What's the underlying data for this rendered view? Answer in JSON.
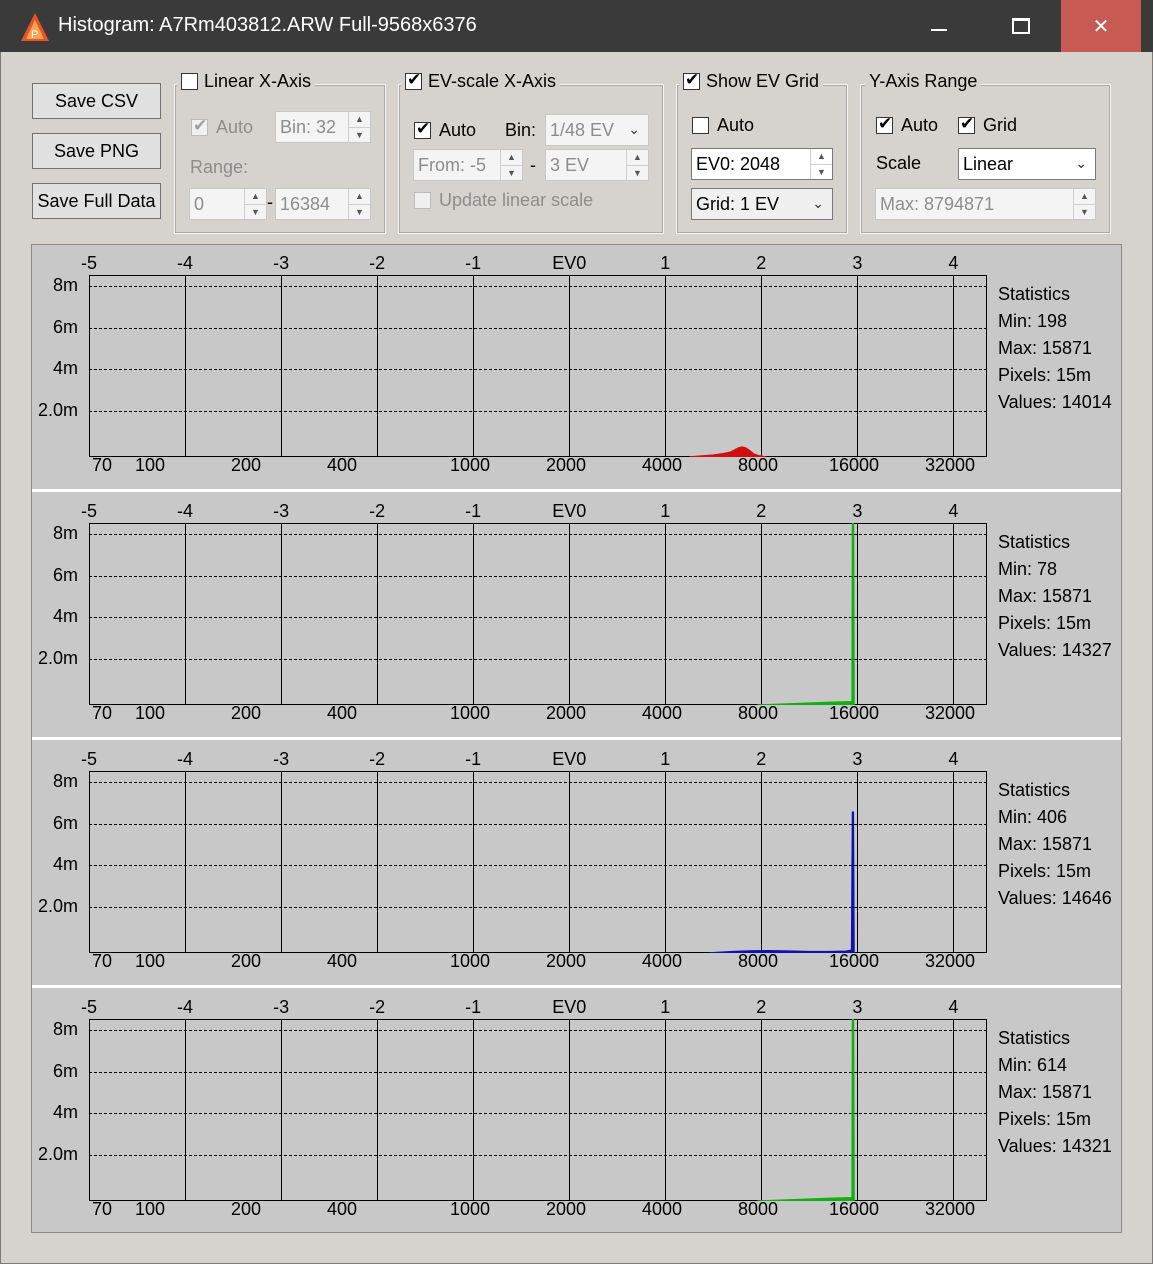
{
  "window": {
    "title": "Histogram: A7Rm403812.ARW Full-9568x6376",
    "minimize_icon": "minimize-icon",
    "maximize_icon": "maximize-icon",
    "close_label": "✕"
  },
  "buttons": {
    "save_csv": "Save CSV",
    "save_png": "Save PNG",
    "save_full": "Save Full Data"
  },
  "linear": {
    "title": "Linear X-Axis",
    "checked": false,
    "auto_label": "Auto",
    "auto_checked": true,
    "bin": "Bin: 32",
    "range_label": "Range:",
    "range_from": "0",
    "range_dash": "-",
    "range_to": "16384"
  },
  "ev": {
    "title": "EV-scale X-Axis",
    "checked": true,
    "auto_label": "Auto",
    "auto_checked": true,
    "bin_label": "Bin:",
    "bin_value": "1/48 EV",
    "from": "From: -5",
    "dash": "-",
    "to": "3 EV",
    "update_label": "Update linear scale",
    "update_checked": false
  },
  "evgrid": {
    "title": "Show EV Grid",
    "checked": true,
    "auto_label": "Auto",
    "auto_checked": false,
    "ev0": "EV0: 2048",
    "grid": "Grid: 1 EV"
  },
  "yaxis": {
    "title": "Y-Axis Range",
    "auto_label": "Auto",
    "auto_checked": true,
    "grid_label": "Grid",
    "grid_checked": true,
    "scale_label": "Scale",
    "scale_value": "Linear",
    "max": "Max: 8794871"
  },
  "chart_data": [
    {
      "type": "area",
      "channel": "red",
      "color": "#d01010",
      "ev_ticks": [
        "-5",
        "-4",
        "-3",
        "-2",
        "-1",
        "EV0",
        "1",
        "2",
        "3",
        "4"
      ],
      "value_ticks": [
        "70",
        "100",
        "200",
        "400",
        "1000",
        "2000",
        "4000",
        "8000",
        "16000",
        "32000"
      ],
      "y_ticks": [
        "8m",
        "6m",
        "4m",
        "2.0m"
      ],
      "xlim_ev": [
        -5,
        4.35
      ],
      "ylim": [
        0,
        8794871
      ],
      "x": [
        1.25,
        1.5,
        1.6,
        1.68,
        1.72,
        1.76,
        1.8,
        1.84,
        1.88,
        1.92,
        1.98,
        2.05
      ],
      "y": [
        0,
        90000,
        160000,
        230000,
        330000,
        430000,
        480000,
        430000,
        300000,
        150000,
        50000,
        0
      ],
      "stats": {
        "title": "Statistics",
        "min": "Min: 198",
        "max": "Max: 15871",
        "pixels": "Pixels: 15m",
        "values": "Values: 14014"
      }
    },
    {
      "type": "area",
      "channel": "green",
      "color": "#10b010",
      "ev_ticks": [
        "-5",
        "-4",
        "-3",
        "-2",
        "-1",
        "EV0",
        "1",
        "2",
        "3",
        "4"
      ],
      "value_ticks": [
        "70",
        "100",
        "200",
        "400",
        "1000",
        "2000",
        "4000",
        "8000",
        "16000",
        "32000"
      ],
      "y_ticks": [
        "8m",
        "6m",
        "4m",
        "2.0m"
      ],
      "xlim_ev": [
        -5,
        4.35
      ],
      "ylim": [
        0,
        8794871
      ],
      "x": [
        1.96,
        2.2,
        2.5,
        2.75,
        2.9,
        2.945,
        2.95,
        2.96,
        2.965
      ],
      "y": [
        0,
        40000,
        90000,
        130000,
        150000,
        160000,
        8794871,
        8794871,
        0
      ],
      "stats": {
        "title": "Statistics",
        "min": "Min: 78",
        "max": "Max: 15871",
        "pixels": "Pixels: 15m",
        "values": "Values: 14327"
      }
    },
    {
      "type": "area",
      "channel": "blue",
      "color": "#1010b0",
      "ev_ticks": [
        "-5",
        "-4",
        "-3",
        "-2",
        "-1",
        "EV0",
        "1",
        "2",
        "3",
        "4"
      ],
      "value_ticks": [
        "70",
        "100",
        "200",
        "400",
        "1000",
        "2000",
        "4000",
        "8000",
        "16000",
        "32000"
      ],
      "y_ticks": [
        "8m",
        "6m",
        "4m",
        "2.0m"
      ],
      "xlim_ev": [
        -5,
        4.35
      ],
      "ylim": [
        0,
        8794871
      ],
      "x": [
        1.45,
        1.7,
        1.9,
        2.1,
        2.3,
        2.5,
        2.7,
        2.88,
        2.94,
        2.95,
        2.958,
        2.965
      ],
      "y": [
        0,
        70000,
        100000,
        110000,
        90000,
        70000,
        70000,
        80000,
        130000,
        6800000,
        6800000,
        0
      ],
      "stats": {
        "title": "Statistics",
        "min": "Min: 406",
        "max": "Max: 15871",
        "pixels": "Pixels: 15m",
        "values": "Values: 14646"
      }
    },
    {
      "type": "area",
      "channel": "green",
      "color": "#10b010",
      "ev_ticks": [
        "-5",
        "-4",
        "-3",
        "-2",
        "-1",
        "EV0",
        "1",
        "2",
        "3",
        "4"
      ],
      "value_ticks": [
        "70",
        "100",
        "200",
        "400",
        "1000",
        "2000",
        "4000",
        "8000",
        "16000",
        "32000"
      ],
      "y_ticks": [
        "8m",
        "6m",
        "4m",
        "2.0m"
      ],
      "xlim_ev": [
        -5,
        4.35
      ],
      "ylim": [
        0,
        8794871
      ],
      "x": [
        1.96,
        2.2,
        2.5,
        2.75,
        2.9,
        2.945,
        2.95,
        2.96,
        2.965
      ],
      "y": [
        0,
        40000,
        90000,
        130000,
        150000,
        160000,
        8794871,
        8794871,
        0
      ],
      "stats": {
        "title": "Statistics",
        "min": "Min: 614",
        "max": "Max: 15871",
        "pixels": "Pixels: 15m",
        "values": "Values: 14321"
      }
    }
  ]
}
